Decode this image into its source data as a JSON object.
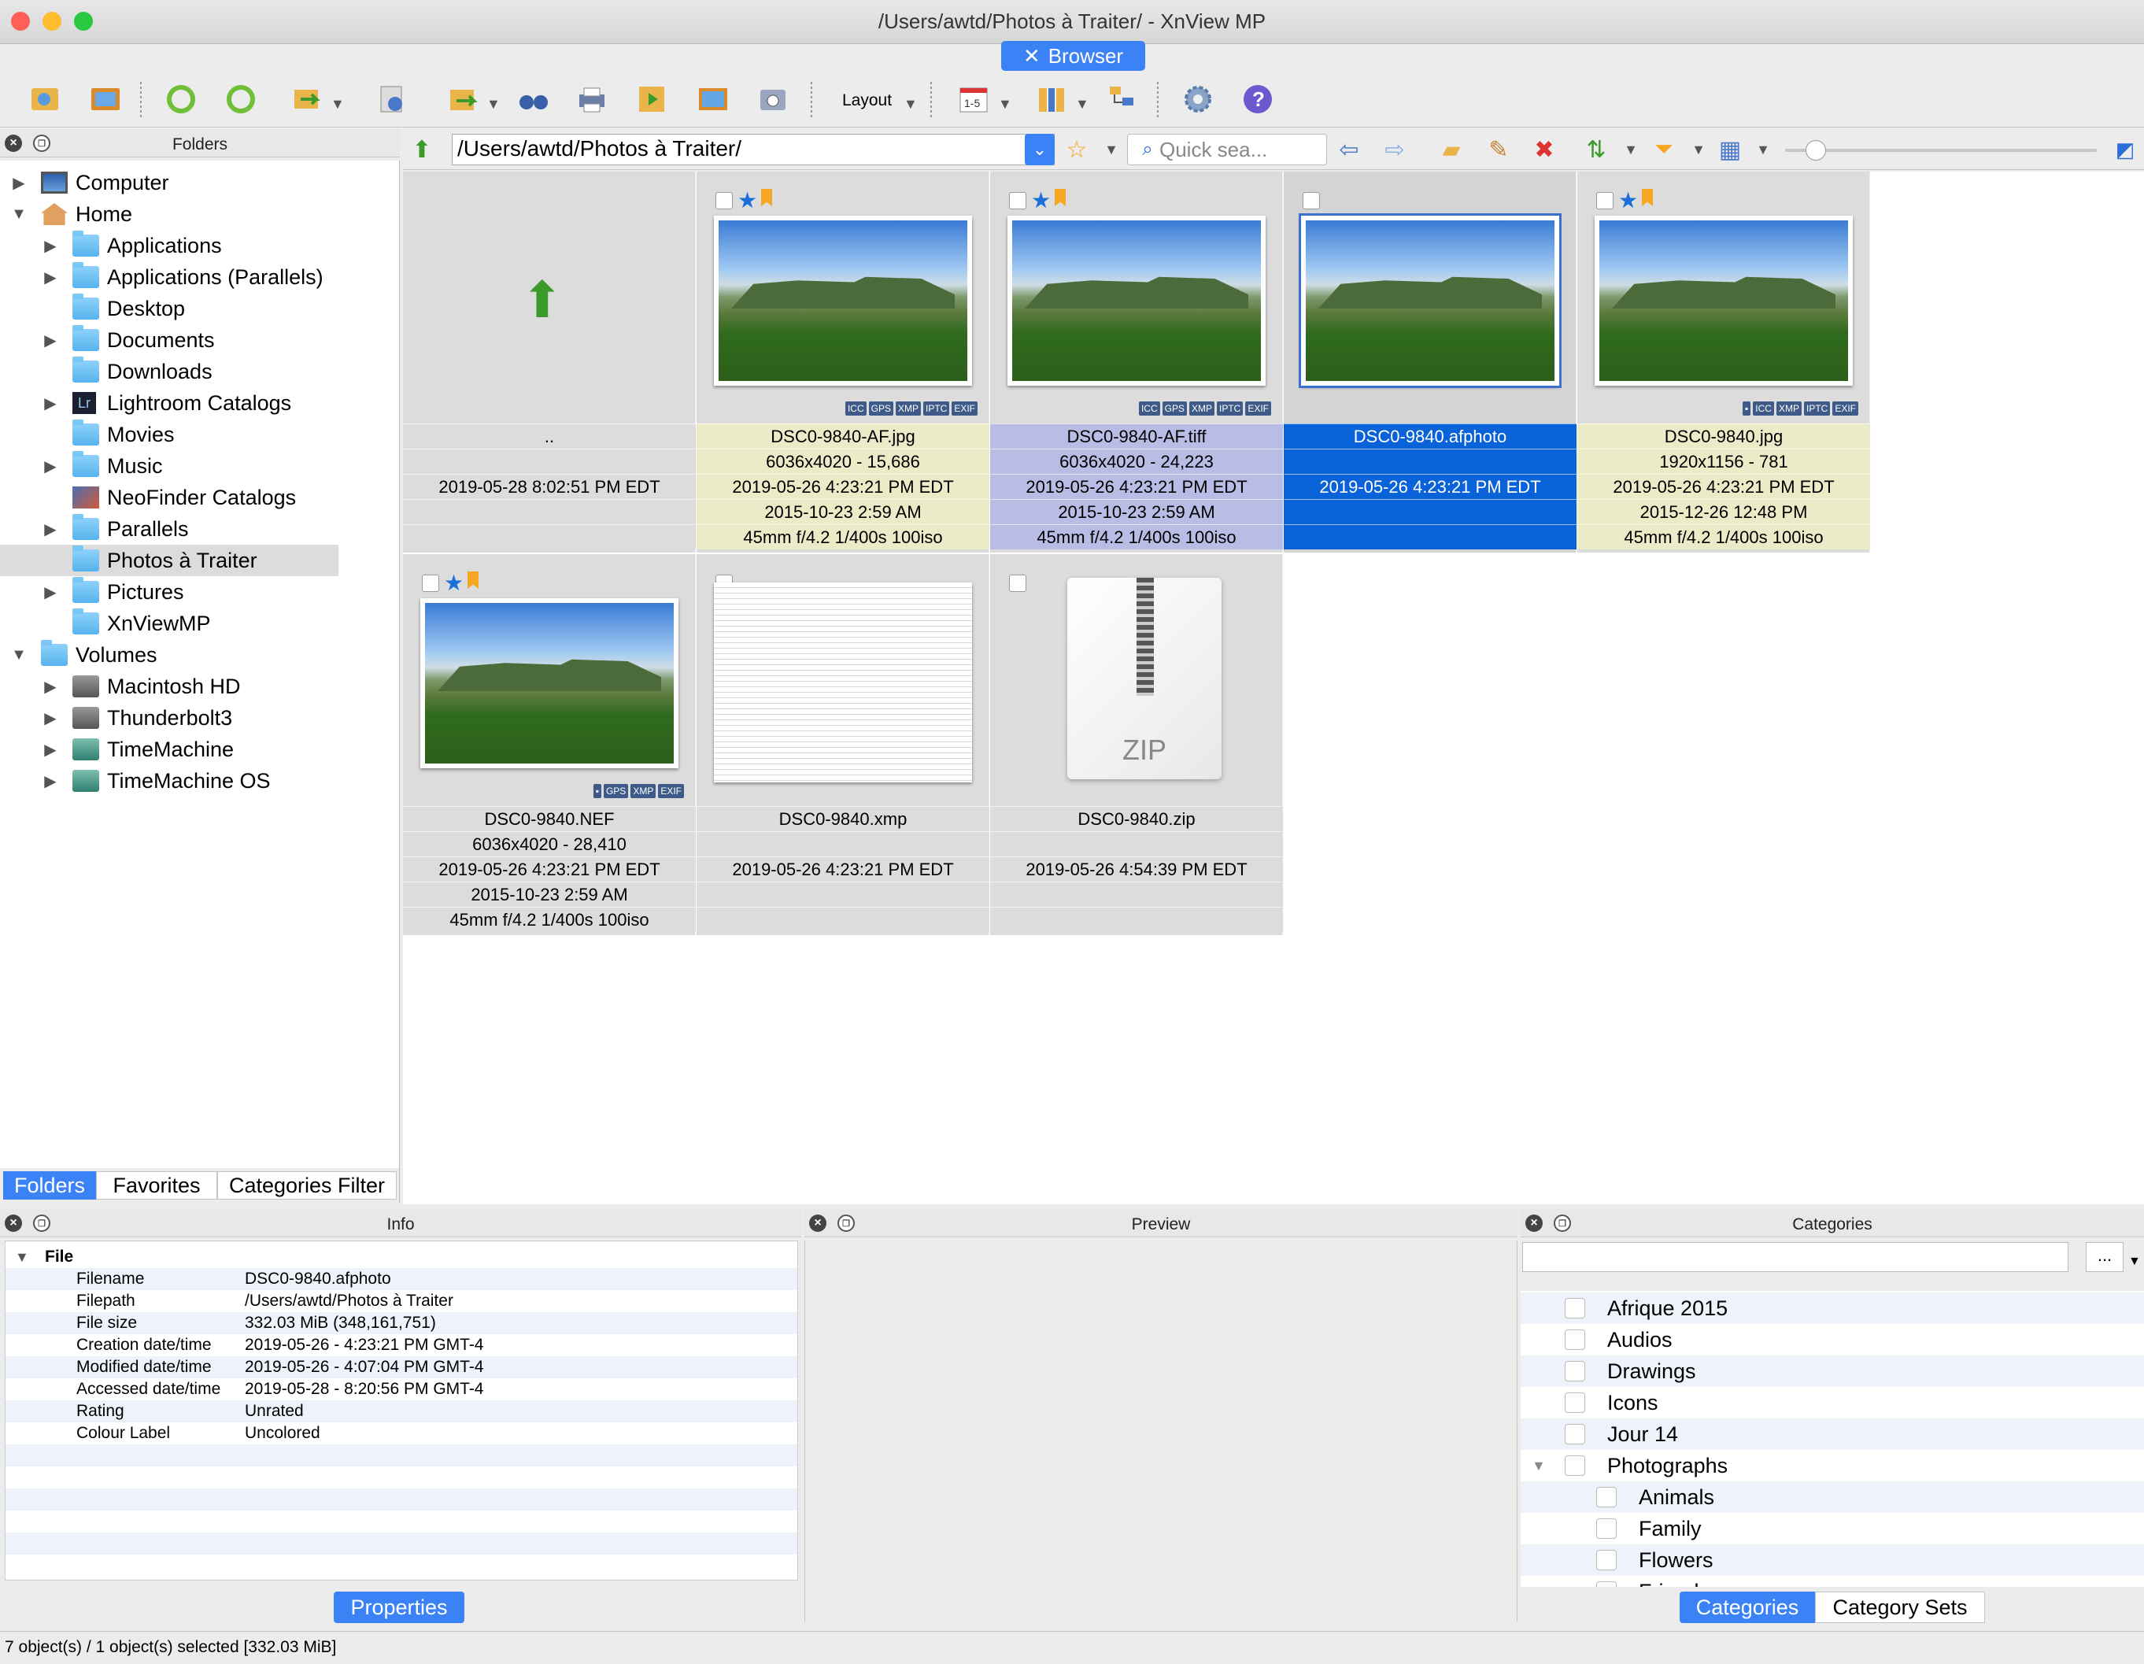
{
  "window": {
    "title": "/Users/awtd/Photos à Traiter/ - XnView MP",
    "active_tab": "Browser"
  },
  "toolbar": {
    "layout_label": "Layout"
  },
  "folders_panel": {
    "title": "Folders"
  },
  "tree": [
    {
      "label": "Computer",
      "icon": "computer-icon",
      "expand": "closed",
      "level": 0
    },
    {
      "label": "Home",
      "icon": "home-icon",
      "expand": "open",
      "level": 0
    },
    {
      "label": "Applications",
      "icon": "folder-icon",
      "expand": "closed",
      "level": 1
    },
    {
      "label": "Applications (Parallels)",
      "icon": "folder-icon",
      "expand": "closed",
      "level": 1
    },
    {
      "label": "Desktop",
      "icon": "folder-icon",
      "expand": "none",
      "level": 1
    },
    {
      "label": "Documents",
      "icon": "folder-icon",
      "expand": "closed",
      "level": 1
    },
    {
      "label": "Downloads",
      "icon": "folder-icon",
      "expand": "none",
      "level": 1
    },
    {
      "label": "Lightroom Catalogs",
      "icon": "lightroom-icon",
      "expand": "closed",
      "level": 1
    },
    {
      "label": "Movies",
      "icon": "folder-icon",
      "expand": "none",
      "level": 1
    },
    {
      "label": "Music",
      "icon": "folder-icon",
      "expand": "closed",
      "level": 1
    },
    {
      "label": "NeoFinder Catalogs",
      "icon": "neofinder-icon",
      "expand": "none",
      "level": 1
    },
    {
      "label": "Parallels",
      "icon": "folder-icon",
      "expand": "closed",
      "level": 1
    },
    {
      "label": "Photos à Traiter",
      "icon": "folder-icon",
      "expand": "none",
      "level": 1,
      "selected": true
    },
    {
      "label": "Pictures",
      "icon": "folder-icon",
      "expand": "closed",
      "level": 1
    },
    {
      "label": "XnViewMP",
      "icon": "folder-icon",
      "expand": "none",
      "level": 1
    },
    {
      "label": "Volumes",
      "icon": "folder-icon",
      "expand": "open",
      "level": 0
    },
    {
      "label": "Macintosh HD",
      "icon": "disk-icon",
      "expand": "closed",
      "level": 1
    },
    {
      "label": "Thunderbolt3",
      "icon": "disk-icon",
      "expand": "closed",
      "level": 1
    },
    {
      "label": "TimeMachine",
      "icon": "timemachine-icon",
      "expand": "closed",
      "level": 1
    },
    {
      "label": "TimeMachine OS",
      "icon": "timemachine-icon",
      "expand": "closed",
      "level": 1
    }
  ],
  "left_tabs": [
    "Folders",
    "Favorites",
    "Categories Filter"
  ],
  "address": {
    "path": "/Users/awtd/Photos à Traiter/",
    "quick_search_placeholder": "Quick sea..."
  },
  "files": [
    {
      "name": "..",
      "lines": [
        "..",
        "",
        "2019-05-28 8:02:51 PM EDT",
        "",
        ""
      ],
      "kind": "parent"
    },
    {
      "name": "DSC0-9840-AF.jpg",
      "lines": [
        "DSC0-9840-AF.jpg",
        "6036x4020 - 15,686",
        "2019-05-26 4:23:21 PM EDT",
        "2015-10-23 2:59 AM",
        "45mm f/4.2 1/400s 100iso"
      ],
      "kind": "photo",
      "star": true,
      "flag": true,
      "badges": [
        "ICC",
        "GPS",
        "XMP",
        "IPTC",
        "EXIF"
      ],
      "tint": "yellow"
    },
    {
      "name": "DSC0-9840-AF.tiff",
      "lines": [
        "DSC0-9840-AF.tiff",
        "6036x4020 - 24,223",
        "2019-05-26 4:23:21 PM EDT",
        "2015-10-23 2:59 AM",
        "45mm f/4.2 1/400s 100iso"
      ],
      "kind": "photo",
      "star": true,
      "flag": true,
      "badges": [
        "ICC",
        "GPS",
        "XMP",
        "IPTC",
        "EXIF"
      ],
      "tint": "lavender"
    },
    {
      "name": "DSC0-9840.afphoto",
      "lines": [
        "DSC0-9840.afphoto",
        "",
        "2019-05-26 4:23:21 PM EDT",
        "",
        ""
      ],
      "kind": "photo",
      "selected": true
    },
    {
      "name": "DSC0-9840.jpg",
      "lines": [
        "DSC0-9840.jpg",
        "1920x1156 - 781",
        "2019-05-26 4:23:21 PM EDT",
        "2015-12-26 12:48 PM",
        "45mm f/4.2 1/400s 100iso"
      ],
      "kind": "photo",
      "star": true,
      "flag": true,
      "badges": [
        "▪",
        "ICC",
        "XMP",
        "IPTC",
        "EXIF"
      ],
      "tint": "yellow"
    },
    {
      "name": "DSC0-9840.NEF",
      "lines": [
        "DSC0-9840.NEF",
        "6036x4020 - 28,410",
        "2019-05-26 4:23:21 PM EDT",
        "2015-10-23 2:59 AM",
        "45mm f/4.2 1/400s 100iso"
      ],
      "kind": "photo",
      "star": true,
      "flag": true,
      "badges": [
        "▪",
        "GPS",
        "XMP",
        "EXIF"
      ]
    },
    {
      "name": "DSC0-9840.xmp",
      "lines": [
        "DSC0-9840.xmp",
        "",
        "2019-05-26 4:23:21 PM EDT",
        "",
        ""
      ],
      "kind": "text"
    },
    {
      "name": "DSC0-9840.zip",
      "lines": [
        "DSC0-9840.zip",
        "",
        "2019-05-26 4:54:39 PM EDT",
        "",
        ""
      ],
      "kind": "zip",
      "zip_label": "ZIP"
    }
  ],
  "info_panel": {
    "title": "Info",
    "section": "File",
    "rows": [
      {
        "k": "Filename",
        "v": "DSC0-9840.afphoto"
      },
      {
        "k": "Filepath",
        "v": "/Users/awtd/Photos à Traiter"
      },
      {
        "k": "File size",
        "v": "332.03 MiB (348,161,751)"
      },
      {
        "k": "Creation date/time",
        "v": "2019-05-26 - 4:23:21 PM GMT-4"
      },
      {
        "k": "Modified date/time",
        "v": "2019-05-26 - 4:07:04 PM GMT-4"
      },
      {
        "k": "Accessed date/time",
        "v": "2019-05-28 - 8:20:56 PM GMT-4"
      },
      {
        "k": "Rating",
        "v": "Unrated"
      },
      {
        "k": "Colour Label",
        "v": "Uncolored"
      }
    ],
    "button": "Properties"
  },
  "preview_panel": {
    "title": "Preview"
  },
  "categories_panel": {
    "title": "Categories",
    "more_button": "...",
    "items": [
      {
        "label": "Afrique 2015",
        "level": 0
      },
      {
        "label": "Audios",
        "level": 0
      },
      {
        "label": "Drawings",
        "level": 0
      },
      {
        "label": "Icons",
        "level": 0
      },
      {
        "label": "Jour 14",
        "level": 0
      },
      {
        "label": "Photographs",
        "level": 0,
        "expanded": true
      },
      {
        "label": "Animals",
        "level": 1
      },
      {
        "label": "Family",
        "level": 1
      },
      {
        "label": "Flowers",
        "level": 1
      },
      {
        "label": "Friends",
        "level": 1
      }
    ],
    "tabs": [
      "Categories",
      "Category Sets"
    ]
  },
  "status": "7 object(s) / 1 object(s) selected [332.03 MiB]",
  "colors": {
    "accent": "#3b82f6",
    "selected": "#0a62d8",
    "tint_yellow": "#ebebc8",
    "tint_lavender": "#b9bde6"
  }
}
